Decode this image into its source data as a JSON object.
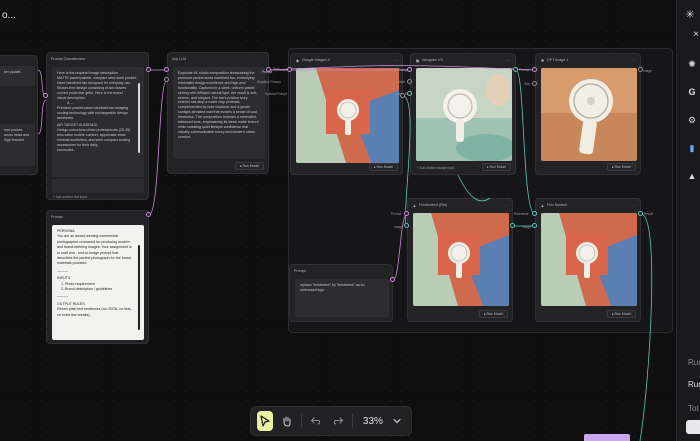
{
  "top_left_label": "o...",
  "nodes": {
    "left_partial": {
      "text_1": "ket pocket-",
      "text_2": "ront pocket-",
      "text_3": "arrow head and",
      "text_4": "high forward"
    },
    "prompt_concat": {
      "title": "Prompt Concatenator",
      "paragraphs": [
        "Here is the required image description",
        "MATTE pastel palette, compact wind-steel pocket-",
        "sized handheld fan designed for everyday use",
        "Sticker-free design consisting of two blades",
        "curved protective grille. Here is the brand",
        "visual description:",
        "A, ...",
        "Premium pocket-sized handheld fan imaging",
        "cooling technology with rechargeable design",
        "aesthetics.",
        "AIR TARGET AUDIENCE",
        "Design-conscious urban professionals (25-45)",
        "who value mobile comfort, appreciate clean",
        "minimal aesthetics, and seek compact cooling",
        "accessories for their daily",
        "commutes."
      ],
      "add_input": "+ Add another text input"
    },
    "prompt_left": {
      "title": "Prompt",
      "lines": [
        "PERSONA",
        "You are an award-winning commercial",
        "photographer renowned for producing modern",
        "and brand-defining images. Your assignment is",
        "to craft one - text-to-image prompt that",
        "describes the perfect photograph for the brand",
        "materials provided.",
        "———",
        "INPUTS",
        "1.    Photo requirement",
        "2.    Brand description / guidelines",
        "———",
        "OUTPUT RULES",
        "Return plain text sentences (no JSON, no lists,",
        "no extra line breaks)."
      ]
    },
    "any_llm": {
      "title": "Any LLM",
      "paragraph": "Exquisite 4K studio composition showcasing the premium pocket-sized handheld fan, embodying minimalist design excellence and high-end functionality. Captured in a sleek, uniform pastel setting with diffused natural light, the result is soft, serene, and elegant. The fan's pristine ivory exterior sits atop a matte clay pedestal, complemented by bold shadows and a gentle sunlight-streaked wall that evokes a sense of cool freshness. The composition features a minimalist, balanced tone, emphasizing its sleek matte texture while radiating quiet lifestyle confidence that visually communicates luxury and modern urban comfort.",
      "run": "▸ Run Model",
      "port_in_1": "Prompt",
      "port_in_2": "Negative Prompt",
      "port_in_3": "System Prompt",
      "port_out": "Text"
    },
    "imagen": {
      "title": "Google Imagen 4",
      "run": "▸ Run Model",
      "port_out": "Image"
    },
    "ideogram": {
      "title": "Ideogram V3",
      "add": "+ Add another image input",
      "run": "▸ Run Model",
      "ports": [
        "Prompt",
        "Style",
        "Image Ref"
      ],
      "port_out": "Image"
    },
    "gpt": {
      "title": "GPT Image 1",
      "run": "▸ Run Model",
      "ports": [
        "Prompt",
        "Size"
      ],
      "port_out": "Image"
    },
    "flux_kontext": {
      "title": "FluxKontext (Ref)",
      "run": "▸ Run Model",
      "ports": [
        "Prompt",
        "Image"
      ],
      "port_out": "Image"
    },
    "flux": {
      "title": "Flux Kontext",
      "run": "▸ Run Model",
      "ports": [
        "Reference",
        "Image"
      ],
      "port_out": "Result"
    },
    "prompt_mid": {
      "title": "Prompt",
      "lines": [
        "replace \"freshness\" by \"freshness\" as an",
        "embossed logo"
      ]
    }
  },
  "toolbar": {
    "zoom": "33%"
  },
  "right_panel": {
    "labels": [
      "Run",
      "Run",
      "Tot"
    ]
  },
  "colors": {
    "accent_green": "#e9f2a2",
    "edge_teal": "#5cc7b5",
    "edge_pink": "#c98bd6"
  }
}
